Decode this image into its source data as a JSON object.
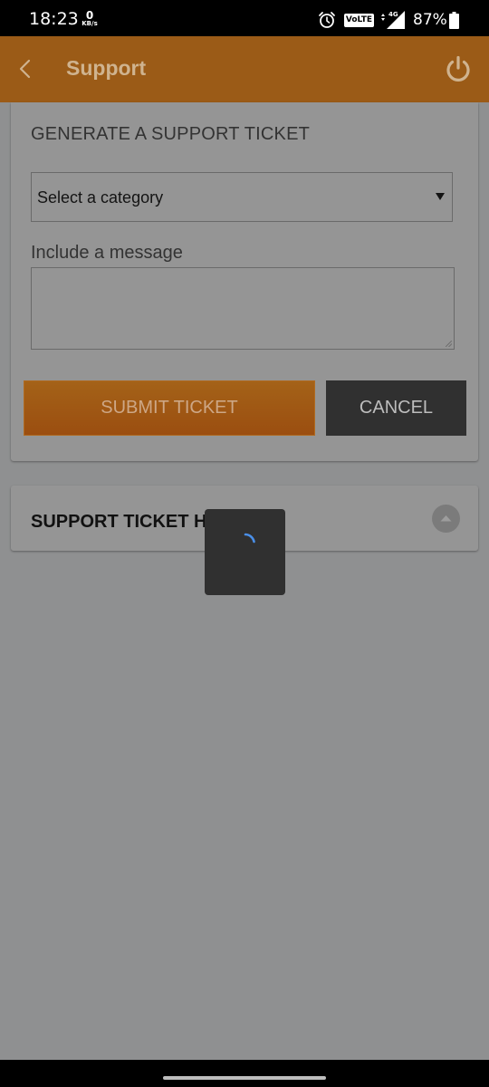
{
  "status_bar": {
    "time": "18:23",
    "net_speed_value": "0",
    "net_speed_unit": "KB/s",
    "volte": "VoLTE",
    "network": "4G",
    "battery_percent": "87%"
  },
  "app_bar": {
    "title": "Support"
  },
  "ticket_form": {
    "heading": "GENERATE A SUPPORT TICKET",
    "category_selected": "Select a category",
    "message_label": "Include a message",
    "message_value": "",
    "submit_label": "SUBMIT TICKET",
    "cancel_label": "CANCEL"
  },
  "history": {
    "title": "SUPPORT TICKET HISTORY"
  },
  "icons": {
    "back": "back-arrow-icon",
    "power": "power-icon",
    "dropdown": "dropdown-triangle-icon",
    "expand": "expand-up-icon",
    "spinner": "loading-spinner-icon",
    "alarm": "alarm-icon",
    "signal": "signal-icon",
    "battery": "battery-icon"
  },
  "colors": {
    "app_bar": "#9b5b17",
    "submit_button": "#a05814",
    "cancel_button": "#303030",
    "spinner": "#4a8fe8",
    "overlay_background": "#8f9091"
  }
}
